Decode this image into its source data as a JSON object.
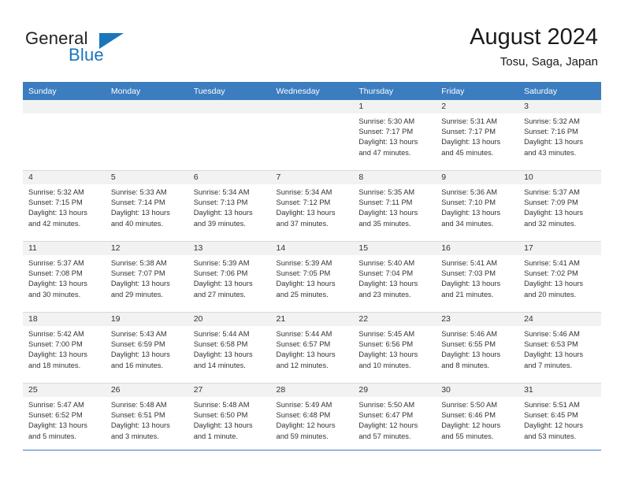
{
  "brand": {
    "word1": "General",
    "word2": "Blue",
    "mark": "triangle-mark"
  },
  "header": {
    "title": "August 2024",
    "subtitle": "Tosu, Saga, Japan"
  },
  "colors": {
    "header_blue": "#3b7dbf",
    "brand_blue": "#1b75bb",
    "daynum_bg": "#f2f2f2",
    "grid_line": "#d9d9d9"
  },
  "weekdays": [
    "Sunday",
    "Monday",
    "Tuesday",
    "Wednesday",
    "Thursday",
    "Friday",
    "Saturday"
  ],
  "weeks": [
    [
      {
        "day": "",
        "lines": []
      },
      {
        "day": "",
        "lines": []
      },
      {
        "day": "",
        "lines": []
      },
      {
        "day": "",
        "lines": []
      },
      {
        "day": "1",
        "lines": [
          "Sunrise: 5:30 AM",
          "Sunset: 7:17 PM",
          "Daylight: 13 hours",
          "and 47 minutes."
        ]
      },
      {
        "day": "2",
        "lines": [
          "Sunrise: 5:31 AM",
          "Sunset: 7:17 PM",
          "Daylight: 13 hours",
          "and 45 minutes."
        ]
      },
      {
        "day": "3",
        "lines": [
          "Sunrise: 5:32 AM",
          "Sunset: 7:16 PM",
          "Daylight: 13 hours",
          "and 43 minutes."
        ]
      }
    ],
    [
      {
        "day": "4",
        "lines": [
          "Sunrise: 5:32 AM",
          "Sunset: 7:15 PM",
          "Daylight: 13 hours",
          "and 42 minutes."
        ]
      },
      {
        "day": "5",
        "lines": [
          "Sunrise: 5:33 AM",
          "Sunset: 7:14 PM",
          "Daylight: 13 hours",
          "and 40 minutes."
        ]
      },
      {
        "day": "6",
        "lines": [
          "Sunrise: 5:34 AM",
          "Sunset: 7:13 PM",
          "Daylight: 13 hours",
          "and 39 minutes."
        ]
      },
      {
        "day": "7",
        "lines": [
          "Sunrise: 5:34 AM",
          "Sunset: 7:12 PM",
          "Daylight: 13 hours",
          "and 37 minutes."
        ]
      },
      {
        "day": "8",
        "lines": [
          "Sunrise: 5:35 AM",
          "Sunset: 7:11 PM",
          "Daylight: 13 hours",
          "and 35 minutes."
        ]
      },
      {
        "day": "9",
        "lines": [
          "Sunrise: 5:36 AM",
          "Sunset: 7:10 PM",
          "Daylight: 13 hours",
          "and 34 minutes."
        ]
      },
      {
        "day": "10",
        "lines": [
          "Sunrise: 5:37 AM",
          "Sunset: 7:09 PM",
          "Daylight: 13 hours",
          "and 32 minutes."
        ]
      }
    ],
    [
      {
        "day": "11",
        "lines": [
          "Sunrise: 5:37 AM",
          "Sunset: 7:08 PM",
          "Daylight: 13 hours",
          "and 30 minutes."
        ]
      },
      {
        "day": "12",
        "lines": [
          "Sunrise: 5:38 AM",
          "Sunset: 7:07 PM",
          "Daylight: 13 hours",
          "and 29 minutes."
        ]
      },
      {
        "day": "13",
        "lines": [
          "Sunrise: 5:39 AM",
          "Sunset: 7:06 PM",
          "Daylight: 13 hours",
          "and 27 minutes."
        ]
      },
      {
        "day": "14",
        "lines": [
          "Sunrise: 5:39 AM",
          "Sunset: 7:05 PM",
          "Daylight: 13 hours",
          "and 25 minutes."
        ]
      },
      {
        "day": "15",
        "lines": [
          "Sunrise: 5:40 AM",
          "Sunset: 7:04 PM",
          "Daylight: 13 hours",
          "and 23 minutes."
        ]
      },
      {
        "day": "16",
        "lines": [
          "Sunrise: 5:41 AM",
          "Sunset: 7:03 PM",
          "Daylight: 13 hours",
          "and 21 minutes."
        ]
      },
      {
        "day": "17",
        "lines": [
          "Sunrise: 5:41 AM",
          "Sunset: 7:02 PM",
          "Daylight: 13 hours",
          "and 20 minutes."
        ]
      }
    ],
    [
      {
        "day": "18",
        "lines": [
          "Sunrise: 5:42 AM",
          "Sunset: 7:00 PM",
          "Daylight: 13 hours",
          "and 18 minutes."
        ]
      },
      {
        "day": "19",
        "lines": [
          "Sunrise: 5:43 AM",
          "Sunset: 6:59 PM",
          "Daylight: 13 hours",
          "and 16 minutes."
        ]
      },
      {
        "day": "20",
        "lines": [
          "Sunrise: 5:44 AM",
          "Sunset: 6:58 PM",
          "Daylight: 13 hours",
          "and 14 minutes."
        ]
      },
      {
        "day": "21",
        "lines": [
          "Sunrise: 5:44 AM",
          "Sunset: 6:57 PM",
          "Daylight: 13 hours",
          "and 12 minutes."
        ]
      },
      {
        "day": "22",
        "lines": [
          "Sunrise: 5:45 AM",
          "Sunset: 6:56 PM",
          "Daylight: 13 hours",
          "and 10 minutes."
        ]
      },
      {
        "day": "23",
        "lines": [
          "Sunrise: 5:46 AM",
          "Sunset: 6:55 PM",
          "Daylight: 13 hours",
          "and 8 minutes."
        ]
      },
      {
        "day": "24",
        "lines": [
          "Sunrise: 5:46 AM",
          "Sunset: 6:53 PM",
          "Daylight: 13 hours",
          "and 7 minutes."
        ]
      }
    ],
    [
      {
        "day": "25",
        "lines": [
          "Sunrise: 5:47 AM",
          "Sunset: 6:52 PM",
          "Daylight: 13 hours",
          "and 5 minutes."
        ]
      },
      {
        "day": "26",
        "lines": [
          "Sunrise: 5:48 AM",
          "Sunset: 6:51 PM",
          "Daylight: 13 hours",
          "and 3 minutes."
        ]
      },
      {
        "day": "27",
        "lines": [
          "Sunrise: 5:48 AM",
          "Sunset: 6:50 PM",
          "Daylight: 13 hours",
          "and 1 minute."
        ]
      },
      {
        "day": "28",
        "lines": [
          "Sunrise: 5:49 AM",
          "Sunset: 6:48 PM",
          "Daylight: 12 hours",
          "and 59 minutes."
        ]
      },
      {
        "day": "29",
        "lines": [
          "Sunrise: 5:50 AM",
          "Sunset: 6:47 PM",
          "Daylight: 12 hours",
          "and 57 minutes."
        ]
      },
      {
        "day": "30",
        "lines": [
          "Sunrise: 5:50 AM",
          "Sunset: 6:46 PM",
          "Daylight: 12 hours",
          "and 55 minutes."
        ]
      },
      {
        "day": "31",
        "lines": [
          "Sunrise: 5:51 AM",
          "Sunset: 6:45 PM",
          "Daylight: 12 hours",
          "and 53 minutes."
        ]
      }
    ]
  ]
}
